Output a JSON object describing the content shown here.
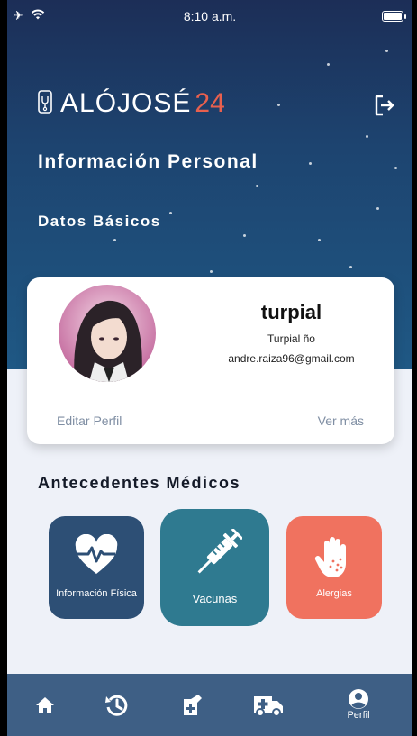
{
  "status_bar": {
    "time": "8:10 a.m."
  },
  "header": {
    "logo_text": "ALÓJOSÉ",
    "logo_number": "24",
    "title": "Información Personal",
    "subtitle": "Datos Básicos"
  },
  "profile": {
    "name": "turpial",
    "subtitle": "Turpial ño",
    "email": "andre.raiza96@gmail.com",
    "edit_label": "Editar Perfil",
    "more_label": "Ver más"
  },
  "medical": {
    "section_title": "Antecedentes Médicos",
    "tiles": [
      {
        "label": "Información Física",
        "icon": "heart-pulse-icon",
        "color": "#2d4f75"
      },
      {
        "label": "Vacunas",
        "icon": "syringe-icon",
        "color": "#2f7a90"
      },
      {
        "label": "Alergias",
        "icon": "allergy-hand-icon",
        "color": "#f0725f"
      }
    ]
  },
  "tabbar": {
    "items": [
      {
        "icon": "home-icon",
        "label": ""
      },
      {
        "icon": "history-icon",
        "label": ""
      },
      {
        "icon": "medical-kit-icon",
        "label": ""
      },
      {
        "icon": "ambulance-icon",
        "label": ""
      },
      {
        "icon": "user-circle-icon",
        "label": "Perfil"
      }
    ]
  },
  "colors": {
    "hero_top": "#1c2e57",
    "hero_bottom": "#1f5884",
    "accent": "#e8604e",
    "tabbar": "#3e5f85"
  }
}
